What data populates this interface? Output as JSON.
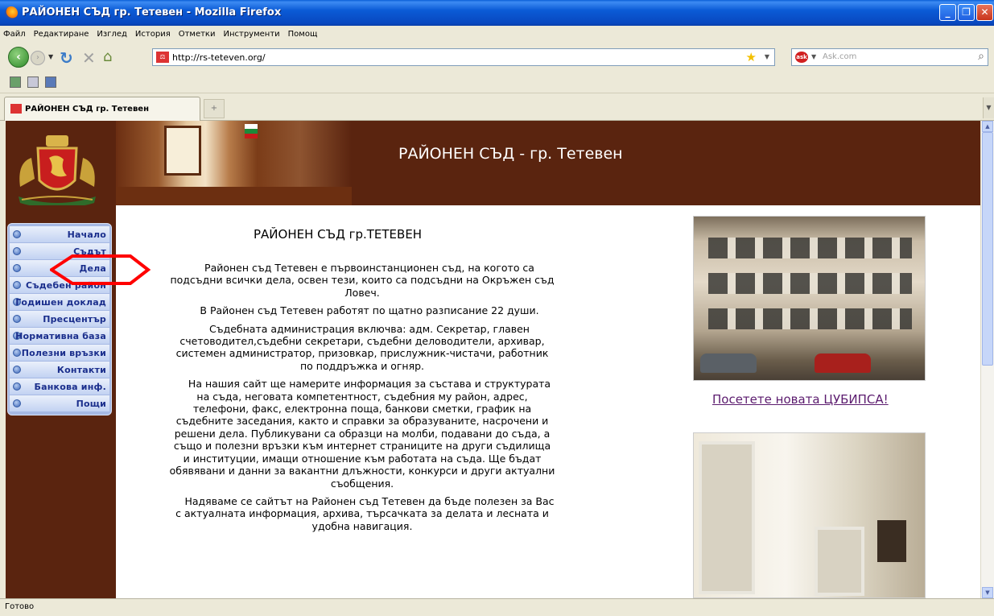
{
  "window": {
    "title": "РАЙОНЕН СЪД гр. Тетевен - Mozilla Firefox"
  },
  "menubar": [
    "Файл",
    "Редактиране",
    "Изглед",
    "История",
    "Отметки",
    "Инструменти",
    "Помощ"
  ],
  "navbar": {
    "url": "http://rs-teteven.org/",
    "search_placeholder": "Ask.com"
  },
  "tab": {
    "label": "РАЙОНЕН СЪД гр. Тетевен"
  },
  "site": {
    "header_title": "РАЙОНЕН СЪД - гр. Тетевен",
    "menu": [
      "Начало",
      "Съдът",
      "Дела",
      "Съдебен район",
      "Годишен доклад",
      "Пресцентър",
      "Нормативна база",
      "Полезни връзки",
      "Контакти",
      "Банкова инф.",
      "Пощи"
    ],
    "heading": "РАЙОНЕН СЪД гр.ТЕТЕВЕН",
    "paragraphs": [
      "Районен съд Тетевен е първоинстанционен съд, на когото са подсъдни всички дела, освен тези, които са подсъдни на Окръжен съд Ловеч.",
      "В Районен съд Тетевен работят по щатно разписание 22 души.",
      "Съдебната администрация включва: адм. Секретар, главен счетоводител,съдебни секретари, съдебни деловодители, архивар, системен администратор, призовкар, прислужник-чистачи, работник по поддръжка и огняр.",
      "На нашия сайт ще намерите информация за състава и структурата на съда, неговата компетентност, съдебния му район, адрес, телефони, факс, електронна поща, банкови сметки, график на съдебните заседания, както и справки за образуваните, насрочени и решени дела. Публикувани са образци на молби, подавани до съда, а също и полезни връзки към интернет страниците на други съдилища и институции, имащи отношение към работата на съда. Ще бъдат обявявани и данни за вакантни длъжности, конкурси и други актуални съобщения.",
      "Надяваме се сайтът на Районен съд Тетевен да бъде полезен за Вас с актуалната информация, архива, търсачката за делата и лесната и удобна навигация."
    ],
    "visit_link": "Посетете новата ЦУБИПСА!"
  },
  "status": {
    "text": "Готово"
  }
}
